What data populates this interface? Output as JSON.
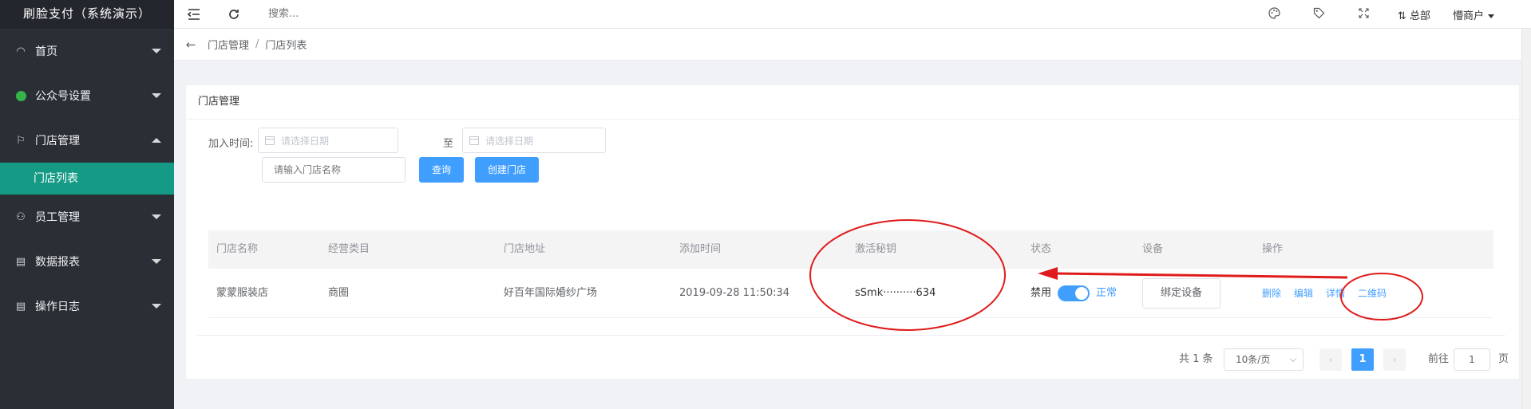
{
  "sidebar": {
    "brand": "刷脸支付（系统演示）",
    "items": [
      {
        "label": "首页",
        "icon": "dashboard-icon",
        "glyph": "◠"
      },
      {
        "label": "公众号设置",
        "icon": "wechat-icon"
      },
      {
        "label": "门店管理",
        "icon": "flag-icon",
        "glyph": "⚐"
      },
      {
        "label": "员工管理",
        "icon": "users-icon",
        "glyph": "⚇"
      },
      {
        "label": "数据报表",
        "icon": "report-icon",
        "glyph": "▤"
      },
      {
        "label": "操作日志",
        "icon": "log-icon",
        "glyph": "▤"
      }
    ],
    "sub_item": "门店列表"
  },
  "topbar": {
    "search_placeholder": "搜索...",
    "org": "总部",
    "account": "懵商户"
  },
  "breadcrumb": [
    "门店管理",
    "门店列表"
  ],
  "card": {
    "title": "门店管理",
    "filter": {
      "join_time_label": "加入时间:",
      "date_placeholder": "请选择日期",
      "to_label": "至",
      "name_placeholder": "请输入门店名称",
      "query_button": "查询",
      "create_button": "创建门店"
    },
    "table": {
      "columns": [
        "门店名称",
        "经营类目",
        "门店地址",
        "添加时间",
        "激活秘钥",
        "状态",
        "设备",
        "操作"
      ],
      "rows": [
        {
          "name": "蒙蒙服装店",
          "category": "商圈",
          "address": "好百年国际婚纱广场",
          "added": "2019-09-28 11:50:34",
          "key": "sSmk··········634",
          "status_off": "禁用",
          "status_on": "正常",
          "bind_button": "绑定设备",
          "ops": [
            "删除",
            "编辑",
            "详情",
            "二维码"
          ]
        }
      ]
    },
    "pager": {
      "total": "共 1 条",
      "page_size": "10条/页",
      "current": "1",
      "goto_label": "前往",
      "goto_value": "1",
      "page_suffix": "页"
    }
  },
  "annotation_color": "#e01b1b"
}
